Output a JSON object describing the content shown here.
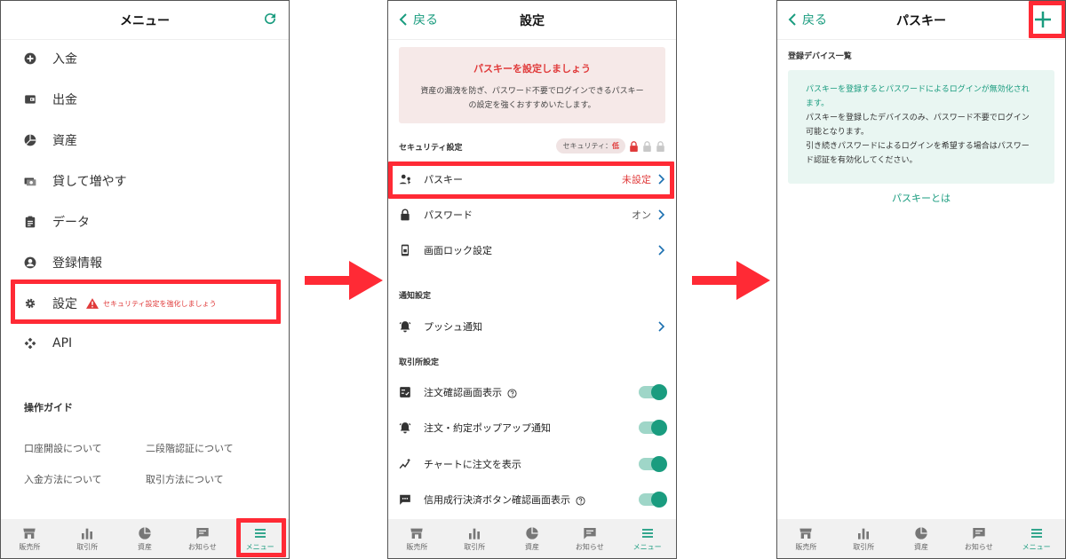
{
  "panel1": {
    "title": "メニュー",
    "menu": [
      {
        "label": "入金",
        "icon": "plus-circle-icon"
      },
      {
        "label": "出金",
        "icon": "wallet-icon"
      },
      {
        "label": "資産",
        "icon": "pie-chart-icon"
      },
      {
        "label": "貸して増やす",
        "icon": "lend-icon"
      },
      {
        "label": "データ",
        "icon": "clipboard-icon"
      },
      {
        "label": "登録情報",
        "icon": "account-icon"
      },
      {
        "label": "設定",
        "icon": "gear-icon"
      },
      {
        "label": "API",
        "icon": "api-icon"
      }
    ],
    "settings_warning": "セキュリティ設定を強化しましょう",
    "guide_title": "操作ガイド",
    "guides": [
      "口座開設について",
      "二段階認証について",
      "入金方法について",
      "取引方法について"
    ]
  },
  "panel2": {
    "back_label": "戻る",
    "title": "設定",
    "alert_title": "パスキーを設定しましょう",
    "alert_body": "資産の漏洩を防ぎ、パスワード不要でログインできるパスキーの設定を強くおすすめいたします。",
    "security_head": "セキュリティ設定",
    "security_level_label": "セキュリティ：",
    "security_level_value": "低",
    "rows": {
      "passkey": {
        "label": "パスキー",
        "value": "未設定"
      },
      "password": {
        "label": "パスワード",
        "value": "オン"
      },
      "screen_lock": {
        "label": "画面ロック設定"
      }
    },
    "notify_head": "通知設定",
    "push": {
      "label": "プッシュ通知"
    },
    "exchange_head": "取引所設定",
    "toggles": [
      {
        "label": "注文確認画面表示",
        "help": true,
        "on": true
      },
      {
        "label": "注文・約定ポップアップ通知",
        "help": false,
        "on": true
      },
      {
        "label": "チャートに注文を表示",
        "help": false,
        "on": true
      },
      {
        "label": "信用成行決済ボタン確認画面表示",
        "help": true,
        "on": true
      }
    ]
  },
  "panel3": {
    "back_label": "戻る",
    "title": "パスキー",
    "device_list_head": "登録デバイス一覧",
    "info_teal": "パスキーを登録するとパスワードによるログインが無効化されます。",
    "info_line2": "パスキーを登録したデバイスのみ、パスワード不要でログイン可能となります。",
    "info_line3": "引き続きパスワードによるログインを希望する場合はパスワード認証を有効化してください。",
    "what_link": "パスキーとは"
  },
  "nav": [
    {
      "label": "販売所",
      "icon": "shop-icon"
    },
    {
      "label": "取引所",
      "icon": "bar-chart-icon"
    },
    {
      "label": "資産",
      "icon": "pie-chart-icon"
    },
    {
      "label": "お知らせ",
      "icon": "message-icon"
    },
    {
      "label": "メニュー",
      "icon": "hamburger-icon"
    }
  ],
  "colors": {
    "accent": "#1a9c7f",
    "highlight": "#ff2a35",
    "warning": "#e03a3a"
  }
}
